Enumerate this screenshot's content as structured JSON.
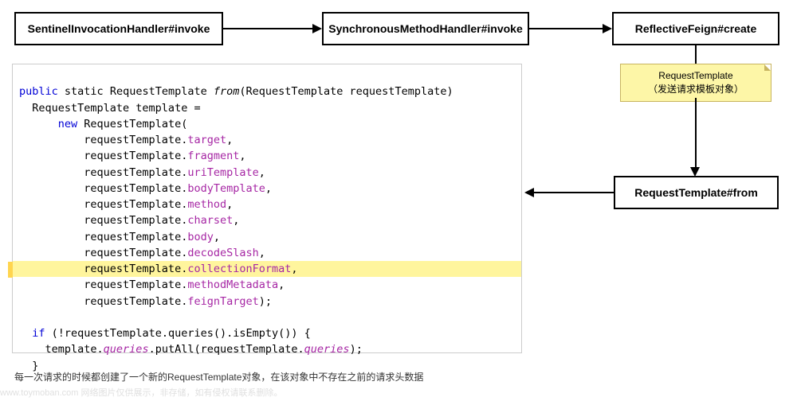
{
  "boxes": {
    "b1": "SentinelInvocationHandler#invoke",
    "b2": "SynchronousMethodHandler#invoke",
    "b3": "ReflectiveFeign#create",
    "b4": "RequestTemplate#from"
  },
  "note": {
    "title": "RequestTemplate",
    "subtitle": "（发送请求模板对象）"
  },
  "code": {
    "l1a": "public",
    "l1b": " static ",
    "l1c": "RequestTemplate ",
    "l1d": "from",
    "l1e": "(RequestTemplate requestTemplate)",
    "l2": "  RequestTemplate template =",
    "l3a": "      ",
    "l3b": "new ",
    "l3c": "RequestTemplate(",
    "p_pre": "          requestTemplate.",
    "p1": "target",
    "p2": "fragment",
    "p3": "uriTemplate",
    "p4": "bodyTemplate",
    "p5": "method",
    "p6": "charset",
    "p7": "body",
    "p8": "decodeSlash",
    "p9": "collectionFormat",
    "p10": "methodMetadata",
    "p11": "feignTarget",
    "comma": ",",
    "close": ");",
    "blank": "",
    "if1a": "  ",
    "if1b": "if ",
    "if1c": "(!requestTemplate.queries().isEmpty()) {",
    "if2a": "    template.",
    "if2b": "queries",
    "if2c": ".putAll(requestTemplate.",
    "if2d": "queries",
    "if2e": ");",
    "if3": "  }"
  },
  "footer": "每一次请求的时候都创建了一个新的RequestTemplate对象，在该对象中不存在之前的请求头数据",
  "watermark": "www.toymoban.com 网络图片仅供展示，非存储，如有侵权请联系删除。"
}
